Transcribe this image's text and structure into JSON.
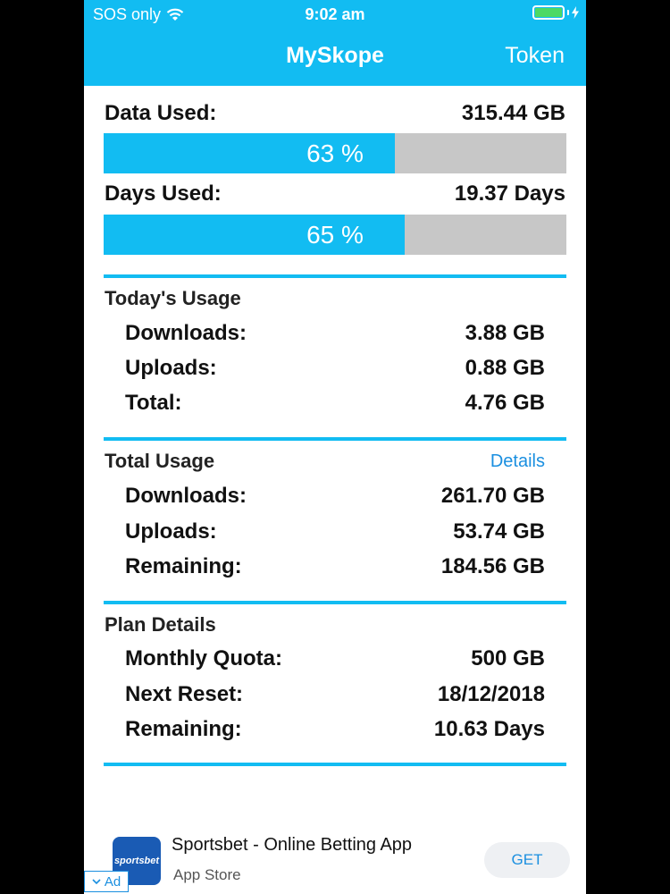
{
  "status_bar": {
    "carrier": "SOS only",
    "time": "9:02 am"
  },
  "nav": {
    "title": "MySkope",
    "token_label": "Token"
  },
  "summary": {
    "data_used_label": "Data Used:",
    "data_used_value": "315.44 GB",
    "data_percent_label": "63 %",
    "data_percent": 63,
    "days_used_label": "Days Used:",
    "days_used_value": "19.37 Days",
    "days_percent_label": "65 %",
    "days_percent": 65
  },
  "today": {
    "title": "Today's Usage",
    "items": [
      {
        "label": "Downloads:",
        "value": "3.88 GB"
      },
      {
        "label": "Uploads:",
        "value": "0.88 GB"
      },
      {
        "label": "Total:",
        "value": "4.76 GB"
      }
    ]
  },
  "total": {
    "title": "Total Usage",
    "details_label": "Details",
    "items": [
      {
        "label": "Downloads:",
        "value": "261.70 GB"
      },
      {
        "label": "Uploads:",
        "value": "53.74 GB"
      },
      {
        "label": "Remaining:",
        "value": "184.56 GB"
      }
    ]
  },
  "plan": {
    "title": "Plan Details",
    "items": [
      {
        "label": "Monthly Quota:",
        "value": "500 GB"
      },
      {
        "label": "Next Reset:",
        "value": "18/12/2018"
      },
      {
        "label": "Remaining:",
        "value": "10.63 Days"
      }
    ]
  },
  "ad": {
    "icon_text": "sportsbet",
    "title": "Sportsbet - Online Betting App",
    "subtitle": "App Store",
    "get_label": "GET",
    "badge_label": "Ad"
  },
  "colors": {
    "accent": "#12bcf2",
    "bar_bg": "#c7c7c7",
    "link": "#1a8fe0"
  }
}
